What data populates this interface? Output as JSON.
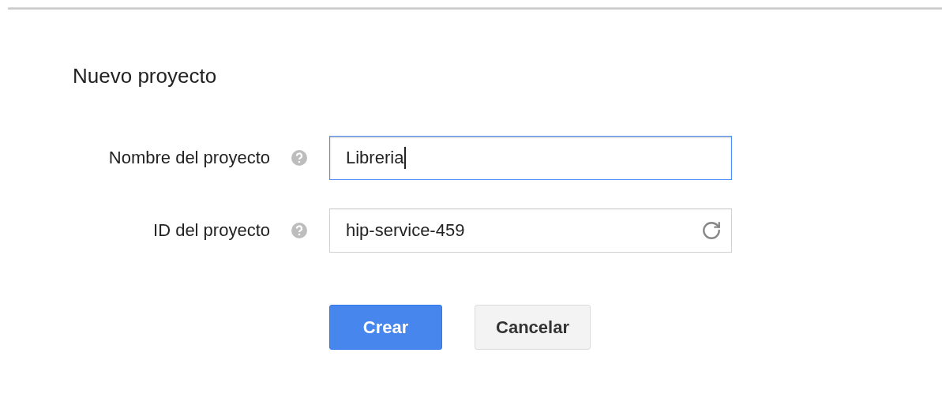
{
  "dialog": {
    "title": "Nuevo proyecto",
    "fields": [
      {
        "kind": "text",
        "label": "Nombre del proyecto",
        "value": "Libreria",
        "focused": true
      },
      {
        "kind": "refresh",
        "label": "ID del proyecto",
        "value": "hip-service-459",
        "focused": false
      }
    ],
    "buttons": [
      {
        "kind": "primary",
        "label": "Crear"
      },
      {
        "kind": "secondary",
        "label": "Cancelar"
      }
    ]
  }
}
